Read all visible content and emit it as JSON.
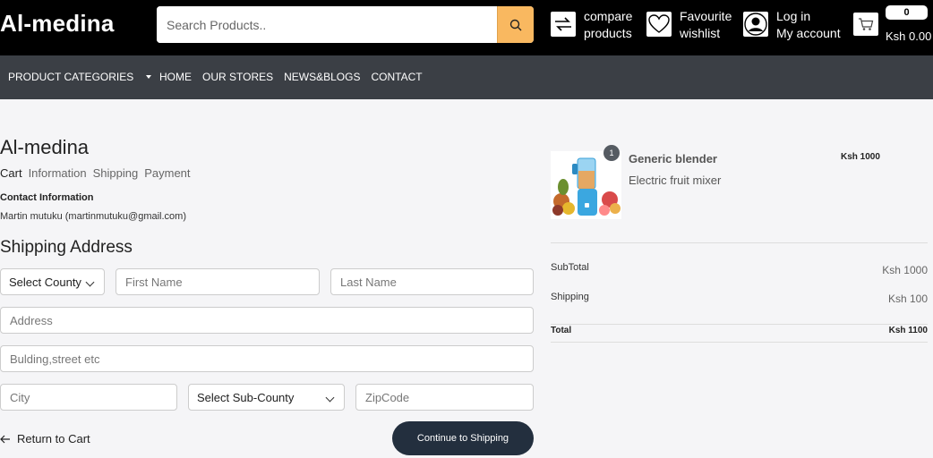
{
  "header": {
    "logo": "Al-medina",
    "search_placeholder": "Search Products..",
    "compare_line1": "compare",
    "compare_line2": "products",
    "wishlist_line1": "Favourite",
    "wishlist_line2": "wishlist",
    "account_line1": "Log in",
    "account_line2": "My account",
    "cart_count": "0",
    "cart_total": "Ksh 0.00",
    "icons": [
      "search-icon",
      "compare-icon",
      "heart-icon",
      "user-icon",
      "cart-icon"
    ],
    "accent_color": "#f9b860"
  },
  "nav": {
    "categories_label": "PRODUCT CATEGORIES",
    "links": [
      "HOME",
      "OUR STORES",
      "NEWS&BLOGS",
      "CONTACT"
    ]
  },
  "checkout": {
    "store_title": "Al-medina",
    "breadcrumbs": [
      "Cart",
      "Information",
      "Shipping",
      "Payment"
    ],
    "contact_heading": "Contact Information",
    "contact_value": "Martin mutuku (martinmutuku@gmail.com)",
    "shipping_heading": "Shipping Address",
    "fields": {
      "county": "Select County",
      "first_name": "First Name",
      "last_name": "Last Name",
      "address": "Address",
      "building": "Bulding,street etc",
      "city": "City",
      "sub_county": "Select Sub-County",
      "zipcode": "ZipCode"
    },
    "return_label": "Return to Cart",
    "continue_label": "Continue to Shipping",
    "button_color": "#232f3e"
  },
  "summary": {
    "product": {
      "name": "Generic blender",
      "description": "Electric fruit mixer",
      "price": "Ksh 1000",
      "quantity": "1"
    },
    "subtotal_label": "SubTotal",
    "subtotal_value": "Ksh 1000",
    "shipping_label": "Shipping",
    "shipping_value": "Ksh 100",
    "total_label": "Total",
    "total_value": "Ksh 1100"
  }
}
